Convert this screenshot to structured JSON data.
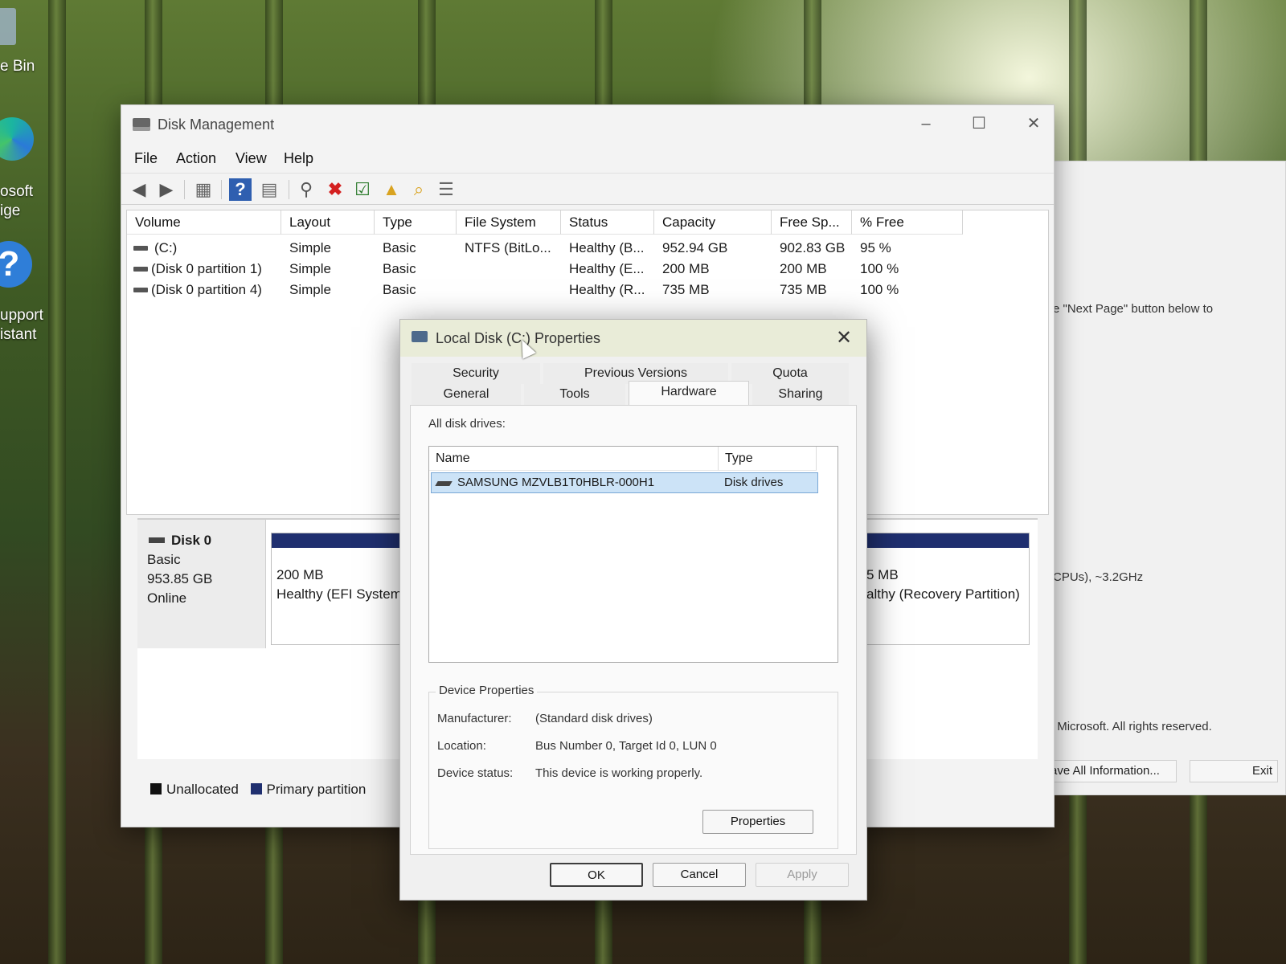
{
  "desktop": {
    "recycle_bin_label": "e Bin",
    "edge_label_1": "osoft",
    "edge_label_2": "ige",
    "support_label_1": "upport",
    "support_label_2": "istant"
  },
  "background_window": {
    "line_next_page": "e \"Next Page\" button below to",
    "cpu_text": "CPUs), ~3.2GHz",
    "copyright": "© Microsoft. All rights reserved.",
    "save_button": "ave All Information...",
    "exit_button": "Exit"
  },
  "disk_management": {
    "title": "Disk Management",
    "menu": [
      "File",
      "Action",
      "View",
      "Help"
    ],
    "columns": [
      "Volume",
      "Layout",
      "Type",
      "File System",
      "Status",
      "Capacity",
      "Free Sp...",
      "% Free"
    ],
    "volumes": [
      {
        "volume": "(C:)",
        "layout": "Simple",
        "type": "Basic",
        "fs": "NTFS (BitLo...",
        "status": "Healthy (B...",
        "capacity": "952.94 GB",
        "free": "902.83 GB",
        "pct": "95 %"
      },
      {
        "volume": "(Disk 0 partition 1)",
        "layout": "Simple",
        "type": "Basic",
        "fs": "",
        "status": "Healthy (E...",
        "capacity": "200 MB",
        "free": "200 MB",
        "pct": "100 %"
      },
      {
        "volume": "(Disk 0 partition 4)",
        "layout": "Simple",
        "type": "Basic",
        "fs": "",
        "status": "Healthy (R...",
        "capacity": "735 MB",
        "free": "735 MB",
        "pct": "100 %"
      }
    ],
    "disk0": {
      "name": "Disk 0",
      "type": "Basic",
      "size": "953.85 GB",
      "state": "Online",
      "part1_size": "200 MB",
      "part1_status": "Healthy (EFI System",
      "part4_size": "5 MB",
      "part4_status": "althy (Recovery Partition)"
    },
    "legend": {
      "unallocated": "Unallocated",
      "primary": "Primary partition"
    },
    "colors": {
      "unallocated": "#111111",
      "primary": "#1f2f6f"
    }
  },
  "properties_dialog": {
    "title": "Local Disk (C:) Properties",
    "tabs_row1": [
      "Security",
      "Previous Versions",
      "Quota"
    ],
    "tabs_row2": [
      "General",
      "Tools",
      "Hardware",
      "Sharing"
    ],
    "active_tab": "Hardware",
    "all_disk_drives_label": "All disk drives:",
    "list_columns": [
      "Name",
      "Type"
    ],
    "drive_name": "SAMSUNG MZVLB1T0HBLR-000H1",
    "drive_type": "Disk drives",
    "device_properties_title": "Device Properties",
    "manufacturer_label": "Manufacturer:",
    "manufacturer_value": "(Standard disk drives)",
    "location_label": "Location:",
    "location_value": "Bus Number 0, Target Id 0, LUN 0",
    "status_label": "Device status:",
    "status_value": "This device is working properly.",
    "properties_button": "Properties",
    "ok_button": "OK",
    "cancel_button": "Cancel",
    "apply_button": "Apply"
  }
}
